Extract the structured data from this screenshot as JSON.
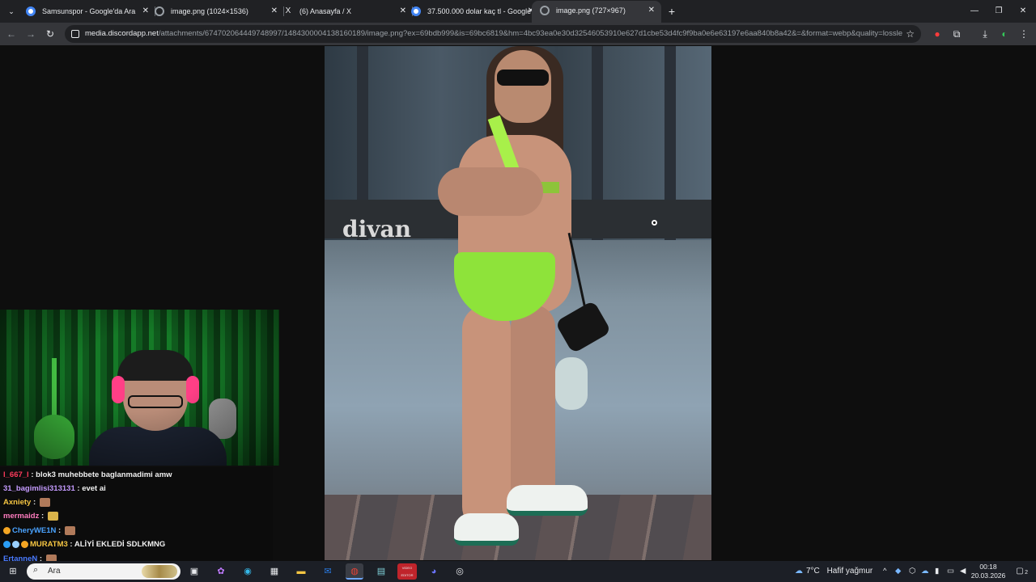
{
  "browser": {
    "tabs": [
      {
        "title": "Samsunspor - Google'da Ara",
        "favicon": "google-g-icon",
        "favicon_color": "#4285f4",
        "active": false
      },
      {
        "title": "image.png (1024×1536)",
        "favicon": "globe-icon",
        "favicon_color": "#9aa0a6",
        "active": false
      },
      {
        "title": "(6) Anasayfa / X",
        "favicon": "x-logo-icon",
        "favicon_color": "#e8eaed",
        "active": false
      },
      {
        "title": "37.500.000 dolar kaç tl - Google",
        "favicon": "google-g-icon",
        "favicon_color": "#4285f4",
        "active": false
      },
      {
        "title": "image.png (727×967)",
        "favicon": "globe-icon",
        "favicon_color": "#9aa0a6",
        "active": true
      }
    ],
    "new_tab_symbol": "+",
    "window_controls": {
      "minimize": "—",
      "restore": "❐",
      "close": "✕"
    },
    "url_host": "media.discordapp.net",
    "url_path": "/attachments/674702064449748997/1484300004138160189/image.png?ex=69bdb999&is=69bc6819&hm=4bc93ea0e30d32546053910e627d1cbe53d4fc9f9ba0e6e63197e6aa840b8a42&=&format=webp&quality=lossles..."
  },
  "image": {
    "sign_text": "divan"
  },
  "chat": {
    "messages": [
      {
        "user": "l_667_l",
        "user_color": "#ff3b5c",
        "text": "blok3 muhebbete baglanmadimi amw",
        "badges": [],
        "emote": ""
      },
      {
        "user": "31_bagimlisi313131",
        "user_color": "#c59bff",
        "text": "evet ai",
        "badges": [],
        "emote": ""
      },
      {
        "user": "Axniety",
        "user_color": "#f5c542",
        "text": "",
        "badges": [],
        "emote": "brown"
      },
      {
        "user": "mermaidz",
        "user_color": "#ff7cbf",
        "text": "",
        "badges": [],
        "emote": "yellow"
      },
      {
        "user": "CheryWE1N",
        "user_color": "#4aa3ff",
        "text": "",
        "badges": [
          "#f5a623"
        ],
        "emote": "brown"
      },
      {
        "user": "MURATM3",
        "user_color": "#f5c542",
        "text": "ALİYİ EKLEDİ SDLKMNG",
        "badges": [
          "#2a9df4",
          "#9ad0ff",
          "#f5a623"
        ],
        "emote": ""
      },
      {
        "user": "ErtanneN",
        "user_color": "#4a7bff",
        "text": "",
        "badges": [],
        "emote": "brown"
      }
    ]
  },
  "taskbar": {
    "search_placeholder": "Ara",
    "weather_temp": "7°C",
    "weather_desc": "Hafif yağmur",
    "time": "00:18",
    "date": "20.03.2026",
    "notification_count": "2",
    "pinned": [
      "task-view-icon",
      "copilot-icon",
      "edge-icon",
      "store-icon",
      "file-explorer-icon",
      "outlook-icon",
      "chrome-icon",
      "notepad-icon",
      "video-editor-icon",
      "discord-icon",
      "obs-icon"
    ],
    "pinned_video_label": "VIDEO EDITOR"
  }
}
